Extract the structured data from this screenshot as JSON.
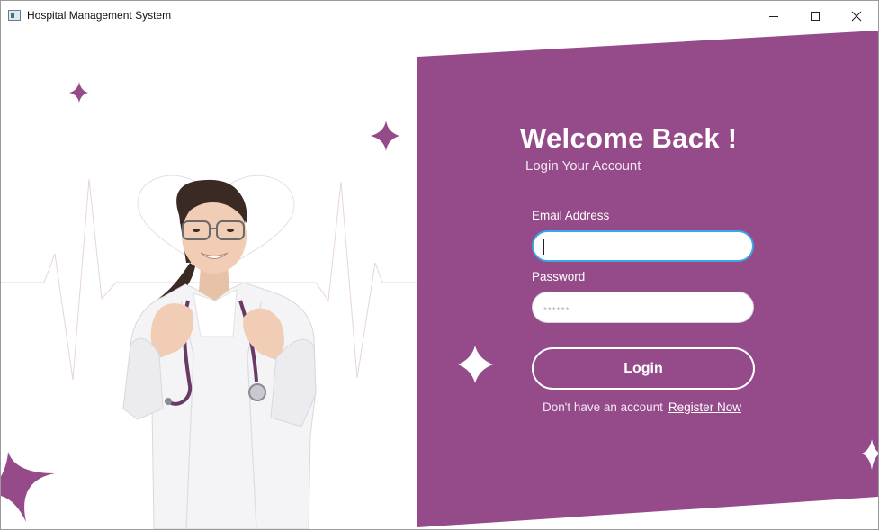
{
  "window": {
    "title": "Hospital Management System",
    "minimize_icon": "minimize-icon",
    "maximize_icon": "maximize-icon",
    "close_icon": "close-icon"
  },
  "colors": {
    "brand_purple": "#954a89",
    "white": "#ffffff",
    "focus_blue": "#3aa7e6"
  },
  "login": {
    "heading": "Welcome Back !",
    "subheading": "Login Your Account",
    "email_label": "Email Address",
    "email_value": "",
    "password_label": "Password",
    "password_placeholder": "******",
    "login_button": "Login",
    "no_account_text": "Don't have an account",
    "register_link": "Register Now"
  },
  "illustration": {
    "subject": "doctor-with-stethoscope",
    "decorations": [
      "sparkle-icon",
      "heartbeat-line",
      "heart-outline"
    ]
  }
}
